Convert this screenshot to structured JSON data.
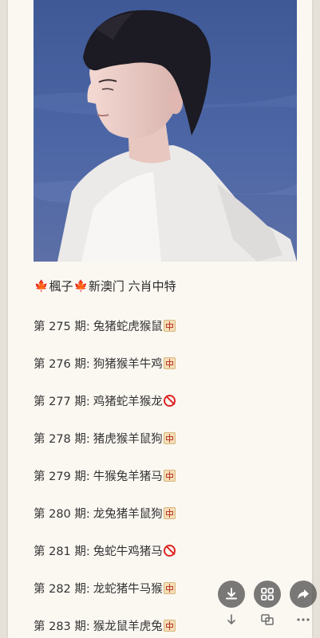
{
  "post": {
    "title_parts": [
      "🍁",
      "楓子",
      "🍁",
      "新澳门 六肖中特"
    ],
    "rows": [
      {
        "period": "第 275 期:",
        "animals": "兔猪蛇虎猴鼠",
        "result": "ok"
      },
      {
        "period": "第 276 期:",
        "animals": "狗猪猴羊牛鸡",
        "result": "ok"
      },
      {
        "period": "第 277 期:",
        "animals": "鸡猪蛇羊猴龙",
        "result": "no"
      },
      {
        "period": "第 278 期:",
        "animals": "猪虎猴羊鼠狗",
        "result": "ok"
      },
      {
        "period": "第 279 期:",
        "animals": "牛猴兔羊猪马",
        "result": "ok"
      },
      {
        "period": "第 280 期:",
        "animals": "龙兔猪羊鼠狗",
        "result": "ok"
      },
      {
        "period": "第 281 期:",
        "animals": "兔蛇牛鸡猪马",
        "result": "no"
      },
      {
        "period": "第 282 期:",
        "animals": "龙蛇猪牛马猴",
        "result": "ok"
      },
      {
        "period": "第 283 期:",
        "animals": "猴龙鼠羊虎兔",
        "result": "ok"
      }
    ]
  },
  "result_marks": {
    "ok": "中-mark-icon",
    "no": "prohibited-icon"
  },
  "actions": [
    {
      "name": "download-icon"
    },
    {
      "name": "grid-icon"
    },
    {
      "name": "share-icon"
    }
  ],
  "sub_icons": [
    "arrow-down-icon",
    "copy-icon",
    "more-icon"
  ]
}
